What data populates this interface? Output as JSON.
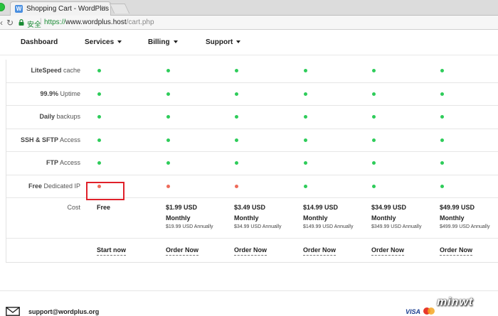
{
  "browser": {
    "tab_title": "Shopping Cart - WordPlus",
    "tab_favicon": "W",
    "tab_close": "×",
    "secure_label": "安全",
    "url_scheme": "https://",
    "url_host": "www.wordplus.host",
    "url_path": "/cart.php"
  },
  "nav": {
    "items": [
      {
        "label": "Dashboard",
        "has_caret": false
      },
      {
        "label": "Services",
        "has_caret": true
      },
      {
        "label": "Billing",
        "has_caret": true
      },
      {
        "label": "Support",
        "has_caret": true
      }
    ]
  },
  "features": [
    {
      "bold": "LiteSpeed",
      "rest": " cache",
      "status": [
        "green",
        "green",
        "green",
        "green",
        "green",
        "green"
      ]
    },
    {
      "bold": "99.9%",
      "rest": " Uptime",
      "status": [
        "green",
        "green",
        "green",
        "green",
        "green",
        "green"
      ]
    },
    {
      "bold": "Daily",
      "rest": " backups",
      "status": [
        "green",
        "green",
        "green",
        "green",
        "green",
        "green"
      ]
    },
    {
      "bold": "SSH & SFTP",
      "rest": " Access",
      "status": [
        "green",
        "green",
        "green",
        "green",
        "green",
        "green"
      ]
    },
    {
      "bold": "FTP",
      "rest": " Access",
      "status": [
        "green",
        "green",
        "green",
        "green",
        "green",
        "green"
      ]
    },
    {
      "bold": "Free",
      "rest": " Dedicated IP",
      "status": [
        "red",
        "red",
        "red",
        "green",
        "green",
        "green"
      ]
    }
  ],
  "cost_label": "Cost",
  "plans": [
    {
      "price": "Free",
      "period": "",
      "annual": "",
      "action": "Start now"
    },
    {
      "price": "$1.99 USD",
      "period": "Monthly",
      "annual": "$19.99 USD Annually",
      "action": "Order Now"
    },
    {
      "price": "$3.49 USD",
      "period": "Monthly",
      "annual": "$34.99 USD Annually",
      "action": "Order Now"
    },
    {
      "price": "$14.99 USD",
      "period": "Monthly",
      "annual": "$149.99 USD Annually",
      "action": "Order Now"
    },
    {
      "price": "$34.99 USD",
      "period": "Monthly",
      "annual": "$349.99 USD Annually",
      "action": "Order Now"
    },
    {
      "price": "$49.99 USD",
      "period": "Monthly",
      "annual": "$499.99 USD Annually",
      "action": "Order Now"
    }
  ],
  "footer": {
    "email": "support@wordplus.org",
    "visa": "VISA"
  },
  "watermark": "minwt",
  "colors": {
    "green": "#2ecc5a",
    "red": "#ee6b5a",
    "highlight": "#e0202a"
  }
}
